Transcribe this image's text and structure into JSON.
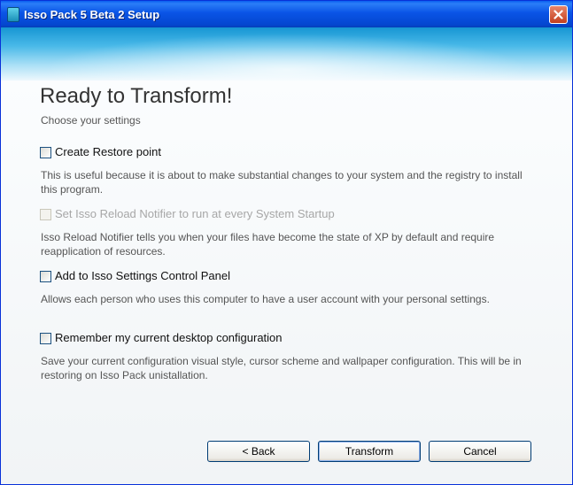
{
  "window": {
    "title": "Isso Pack 5 Beta 2 Setup"
  },
  "page": {
    "heading": "Ready to Transform!",
    "subheading": "Choose your settings"
  },
  "options": [
    {
      "label": "Create Restore point",
      "description": "This is useful because it is about to make substantial changes to your system and the registry to install this program.",
      "checked": false,
      "enabled": true
    },
    {
      "label": "Set Isso Reload Notifier to run at every System Startup",
      "description": "Isso Reload Notifier tells you when your files have become the state of XP by default and require reapplication of resources.",
      "checked": false,
      "enabled": false
    },
    {
      "label": "Add to Isso Settings Control Panel",
      "description": "Allows each person who uses this computer to have a user account with your personal settings.",
      "checked": false,
      "enabled": true
    },
    {
      "label": "Remember my current desktop configuration",
      "description": "Save your current configuration visual style, cursor scheme and wallpaper configuration. This will be in restoring on Isso Pack unistallation.",
      "checked": false,
      "enabled": true
    }
  ],
  "buttons": {
    "back": "< Back",
    "transform": "Transform",
    "cancel": "Cancel"
  },
  "icons": {
    "app": "setup-app-icon",
    "close": "close-icon"
  },
  "colors": {
    "titlebar": "#0a54e6",
    "close_button": "#c3401f",
    "banner": "#49b9e8"
  }
}
